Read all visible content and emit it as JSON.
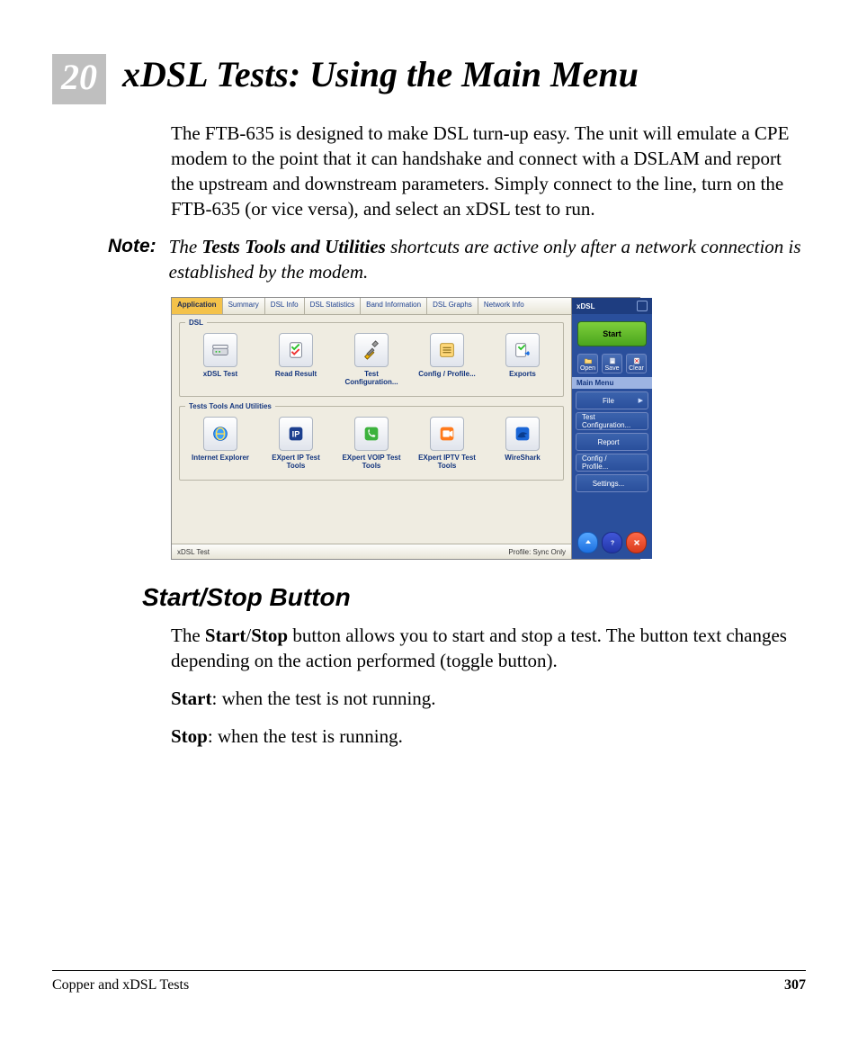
{
  "chapter": {
    "number": "20",
    "title": "xDSL Tests: Using the Main Menu"
  },
  "intro": "The FTB-635 is designed to make DSL turn-up easy. The unit will emulate a CPE modem to the point that it can handshake and connect with a DSLAM and report the upstream and downstream parameters. Simply connect to the line, turn on the FTB-635 (or vice versa), and select an xDSL test to run.",
  "note": {
    "label": "Note:",
    "prefix": "The ",
    "bold": "Tests Tools and Utilities",
    "suffix": " shortcuts are active only after a network connection is established by the modem."
  },
  "screenshot": {
    "tabs": [
      {
        "label": "Application",
        "active": true
      },
      {
        "label": "Summary",
        "active": false
      },
      {
        "label": "DSL Info",
        "active": false
      },
      {
        "label": "DSL Statistics",
        "active": false
      },
      {
        "label": "Band Information",
        "active": false
      },
      {
        "label": "DSL Graphs",
        "active": false
      },
      {
        "label": "Network Info",
        "active": false
      }
    ],
    "group_dsl": {
      "legend": "DSL",
      "items": [
        {
          "label": "xDSL Test",
          "icon": "modem-icon"
        },
        {
          "label": "Read Result",
          "icon": "results-icon"
        },
        {
          "label": "Test Configuration...",
          "icon": "tools-icon"
        },
        {
          "label": "Config / Profile...",
          "icon": "list-icon"
        },
        {
          "label": "Exports",
          "icon": "export-icon"
        }
      ]
    },
    "group_tools": {
      "legend": "Tests Tools And Utilities",
      "items": [
        {
          "label": "Internet Explorer",
          "icon": "ie-icon"
        },
        {
          "label": "EXpert IP Test Tools",
          "icon": "ip-icon"
        },
        {
          "label": "EXpert VOIP Test Tools",
          "icon": "phone-icon"
        },
        {
          "label": "EXpert IPTV Test Tools",
          "icon": "video-icon"
        },
        {
          "label": "WireShark",
          "icon": "shark-icon"
        }
      ]
    },
    "status": {
      "left": "xDSL Test",
      "right": "Profile: Sync Only"
    },
    "side": {
      "title": "xDSL",
      "start": "Start",
      "toolbar": [
        {
          "label": "Open",
          "icon": "folder-open-icon"
        },
        {
          "label": "Save",
          "icon": "save-icon"
        },
        {
          "label": "Clear",
          "icon": "clear-icon"
        }
      ],
      "section": "Main Menu",
      "menu": [
        {
          "label": "File",
          "submenu": true
        },
        {
          "label": "Test Configuration...",
          "submenu": false
        },
        {
          "label": "Report",
          "submenu": false
        },
        {
          "label": "Config / Profile...",
          "submenu": false
        },
        {
          "label": "Settings...",
          "submenu": false
        }
      ],
      "bottom_icons": [
        "up-arrow-icon",
        "help-icon",
        "close-icon"
      ]
    }
  },
  "section2": {
    "heading": "Start/Stop Button",
    "p1_a": "The ",
    "p1_b": "Start",
    "p1_c": "/",
    "p1_d": "Stop",
    "p1_e": " button allows you to start and stop a test. The button text changes depending on the action performed (toggle button).",
    "p2_a": "Start",
    "p2_b": ": when the test is not running.",
    "p3_a": "Stop",
    "p3_b": ": when the test is running."
  },
  "footer": {
    "left": "Copper and xDSL Tests",
    "page": "307"
  }
}
